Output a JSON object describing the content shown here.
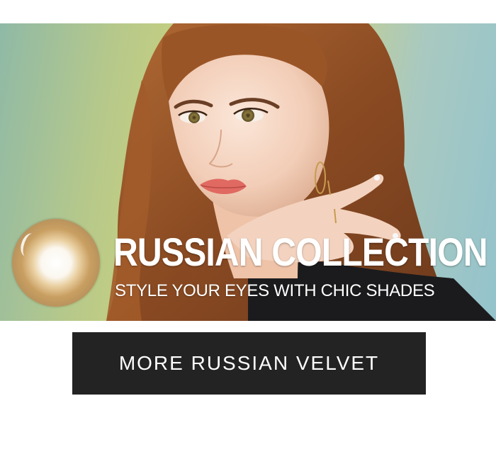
{
  "banner": {
    "image_alt": "model-portrait-photo",
    "lens_icon": "contact-lens-icon",
    "headline": "RUSSIAN COLLECTION",
    "subline": "STYLE YOUR EYES WITH CHIC SHADES"
  },
  "cta": {
    "label": "MORE RUSSIAN VELVET"
  },
  "colors": {
    "cta_background": "#232323",
    "cta_text": "#ffffff",
    "banner_text": "#ffffff",
    "page_background": "#ffffff"
  }
}
